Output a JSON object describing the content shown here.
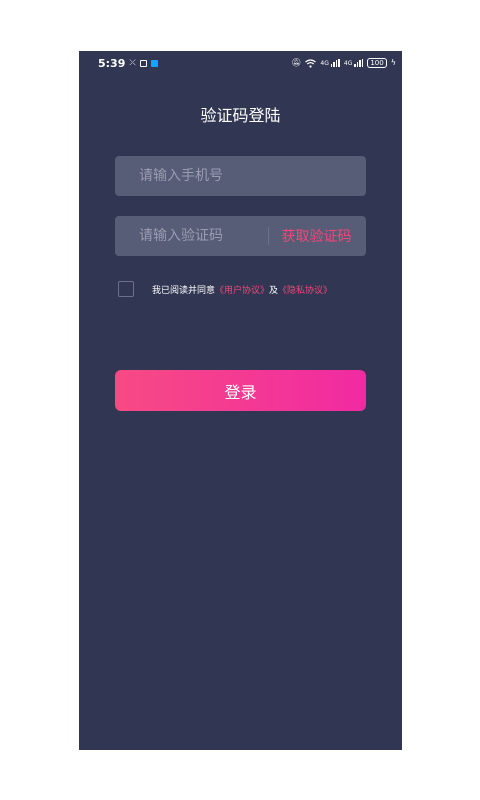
{
  "status_bar": {
    "time": "5:39",
    "battery": "100",
    "network_label_1": "4G",
    "network_label_2": "4G",
    "icons": [
      "missed-call-icon",
      "message-icon",
      "notification-app-icon",
      "mute-icon",
      "wifi-icon",
      "signal-icon",
      "signal-icon",
      "battery-icon",
      "charging-icon"
    ]
  },
  "header": {
    "title": "验证码登陆"
  },
  "form": {
    "phone_placeholder": "请输入手机号",
    "phone_value": "",
    "code_placeholder": "请输入验证码",
    "code_value": "",
    "get_code_label": "获取验证码"
  },
  "agreement": {
    "checked": false,
    "prefix": "我已阅读并同意",
    "user_agreement": "《用户协议》",
    "conjunction": "及",
    "privacy_policy": "《隐私协议》"
  },
  "actions": {
    "login_label": "登录"
  },
  "colors": {
    "background": "#313753",
    "input_bg": "#575c77",
    "accent": "#f04878",
    "button_gradient_start": "#f74a83",
    "button_gradient_end": "#f12aa2"
  }
}
